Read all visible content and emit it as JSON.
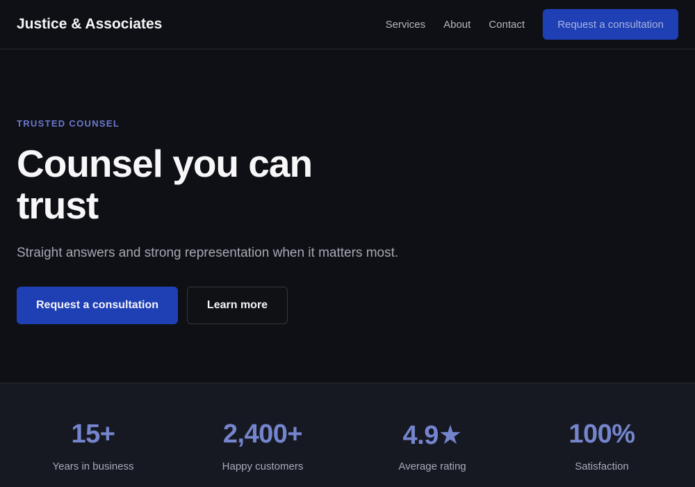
{
  "header": {
    "brand": "Justice & Associates",
    "nav": [
      "Services",
      "About",
      "Contact"
    ],
    "cta": "Request a consultation"
  },
  "hero": {
    "eyebrow": "TRUSTED COUNSEL",
    "title": "Counsel you can trust",
    "subtitle": "Straight answers and strong representation when it matters most.",
    "primary_button": "Request a consultation",
    "secondary_button": "Learn more"
  },
  "stats": [
    {
      "value": "15+",
      "label": "Years in business"
    },
    {
      "value": "2,400+",
      "label": "Happy customers"
    },
    {
      "value": "4.9★",
      "label": "Average rating"
    },
    {
      "value": "100%",
      "label": "Satisfaction"
    }
  ],
  "colors": {
    "background": "#0f1015",
    "accent": "#1f3fb5",
    "stat_text": "#7485cd",
    "eyebrow": "#6a79d0"
  }
}
